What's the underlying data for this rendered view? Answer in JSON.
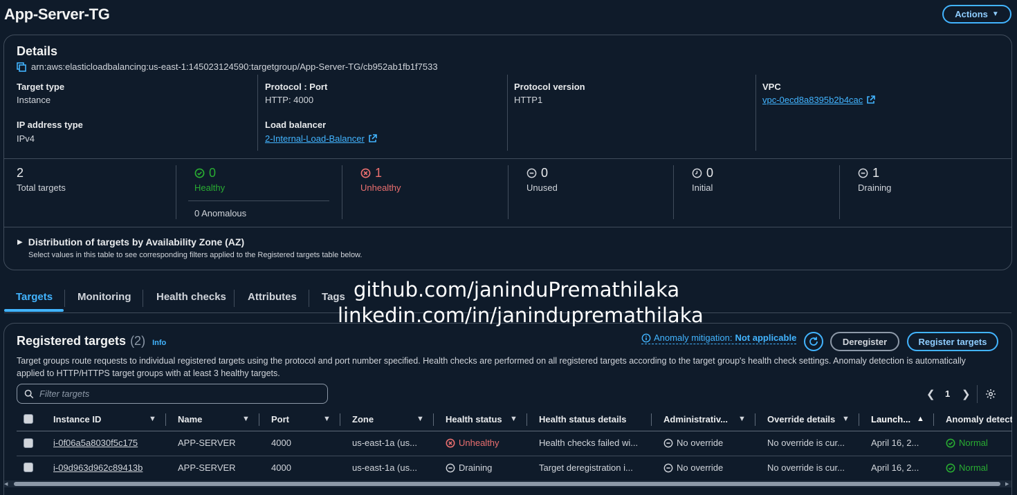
{
  "page": {
    "title": "App-Server-TG",
    "actions_label": "Actions"
  },
  "details": {
    "heading": "Details",
    "arn": "arn:aws:elasticloadbalancing:us-east-1:145023124590:targetgroup/App-Server-TG/cb952ab1fb1f7533",
    "target_type_label": "Target type",
    "target_type_value": "Instance",
    "protocol_port_label": "Protocol : Port",
    "protocol_port_value": "HTTP: 4000",
    "protocol_version_label": "Protocol version",
    "protocol_version_value": "HTTP1",
    "vpc_label": "VPC",
    "vpc_value": "vpc-0ecd8a8395b2b4cac",
    "ip_type_label": "IP address type",
    "ip_type_value": "IPv4",
    "lb_label": "Load balancer",
    "lb_value": "2-Internal-Load-Balancer"
  },
  "stats": {
    "total_value": "2",
    "total_label": "Total targets",
    "healthy_value": "0",
    "healthy_label": "Healthy",
    "anomalous": "0 Anomalous",
    "unhealthy_value": "1",
    "unhealthy_label": "Unhealthy",
    "unused_value": "0",
    "unused_label": "Unused",
    "initial_value": "0",
    "initial_label": "Initial",
    "draining_value": "1",
    "draining_label": "Draining"
  },
  "distribution": {
    "title": "Distribution of targets by Availability Zone (AZ)",
    "subtitle": "Select values in this table to see corresponding filters applied to the Registered targets table below."
  },
  "tabs": [
    "Targets",
    "Monitoring",
    "Health checks",
    "Attributes",
    "Tags"
  ],
  "watermark": {
    "line1": "github.com/janinduPremathilaka",
    "line2": "linkedin.com/in/janindupremathilaka"
  },
  "registered": {
    "title": "Registered targets",
    "count": "(2)",
    "info": "Info",
    "anomaly_prefix": "Anomaly mitigation:",
    "anomaly_value": "Not applicable",
    "deregister": "Deregister",
    "register": "Register targets",
    "description": "Target groups route requests to individual registered targets using the protocol and port number specified. Health checks are performed on all registered targets according to the target group's health check settings. Anomaly detection is automatically applied to HTTP/HTTPS target groups with at least 3 healthy targets.",
    "filter_placeholder": "Filter targets",
    "page_number": "1"
  },
  "table": {
    "headers": [
      "Instance ID",
      "Name",
      "Port",
      "Zone",
      "Health status",
      "Health status details",
      "Administrativ...",
      "Override details",
      "Launch...",
      "Anomaly detect"
    ],
    "rows": [
      {
        "instance_id": "i-0f06a5a8030f5c175",
        "name": "APP-SERVER",
        "port": "4000",
        "zone": "us-east-1a (us...",
        "health": "Unhealthy",
        "health_details": "Health checks failed wi...",
        "admin": "No override",
        "override": "No override is cur...",
        "launch": "April 16, 2...",
        "anomaly": "Normal"
      },
      {
        "instance_id": "i-09d963d962c89413b",
        "name": "APP-SERVER",
        "port": "4000",
        "zone": "us-east-1a (us...",
        "health": "Draining",
        "health_details": "Target deregistration i...",
        "admin": "No override",
        "override": "No override is cur...",
        "launch": "April 16, 2...",
        "anomaly": "Normal"
      }
    ]
  },
  "colors": {
    "background": "#0f1b2a",
    "accent": "#42b4ff",
    "healthy": "#29ad32",
    "unhealthy": "#eb6f6f",
    "border": "#414d5c"
  }
}
